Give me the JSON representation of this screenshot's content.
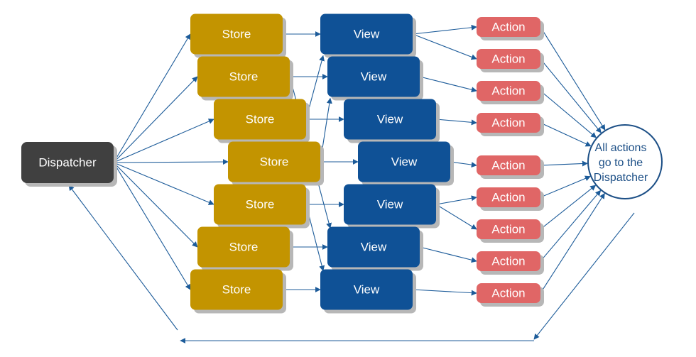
{
  "diagram": {
    "colors": {
      "dispatcher": "#404040",
      "store": "#c39400",
      "view": "#0f5196",
      "action": "#e06666",
      "shadow": "#b7b7b7",
      "edge": "#1c5b99",
      "circle_stroke": "#1c4f86",
      "circle_text": "#1c4f86",
      "node_text": "#ffffff"
    },
    "dispatcher": {
      "label": "Dispatcher"
    },
    "stores": [
      {
        "label": "Store"
      },
      {
        "label": "Store"
      },
      {
        "label": "Store"
      },
      {
        "label": "Store"
      },
      {
        "label": "Store"
      },
      {
        "label": "Store"
      },
      {
        "label": "Store"
      }
    ],
    "views": [
      {
        "label": "View"
      },
      {
        "label": "View"
      },
      {
        "label": "View"
      },
      {
        "label": "View"
      },
      {
        "label": "View"
      },
      {
        "label": "View"
      },
      {
        "label": "View"
      }
    ],
    "actions": [
      {
        "label": "Action"
      },
      {
        "label": "Action"
      },
      {
        "label": "Action"
      },
      {
        "label": "Action"
      },
      {
        "label": "Action"
      },
      {
        "label": "Action"
      },
      {
        "label": "Action"
      },
      {
        "label": "Action"
      },
      {
        "label": "Action"
      }
    ],
    "collector": {
      "lines": [
        "All actions",
        "go to the",
        "Dispatcher"
      ]
    },
    "edges": {
      "dispatcher_to_stores": [
        0,
        1,
        2,
        3,
        4,
        5,
        6
      ],
      "store_to_view": [
        [
          0,
          0
        ],
        [
          1,
          1
        ],
        [
          2,
          2
        ],
        [
          3,
          3
        ],
        [
          4,
          4
        ],
        [
          5,
          5
        ],
        [
          6,
          6
        ],
        [
          1,
          5
        ],
        [
          2,
          0
        ],
        [
          3,
          1
        ],
        [
          4,
          6
        ]
      ],
      "view_to_action": [
        [
          0,
          0
        ],
        [
          0,
          1
        ],
        [
          1,
          2
        ],
        [
          2,
          3
        ],
        [
          3,
          4
        ],
        [
          4,
          5
        ],
        [
          4,
          6
        ],
        [
          5,
          7
        ],
        [
          6,
          8
        ]
      ],
      "actions_to_collector": [
        0,
        1,
        2,
        3,
        4,
        5,
        6,
        7,
        8
      ],
      "return_path": "collector → bottom → dispatcher"
    }
  }
}
